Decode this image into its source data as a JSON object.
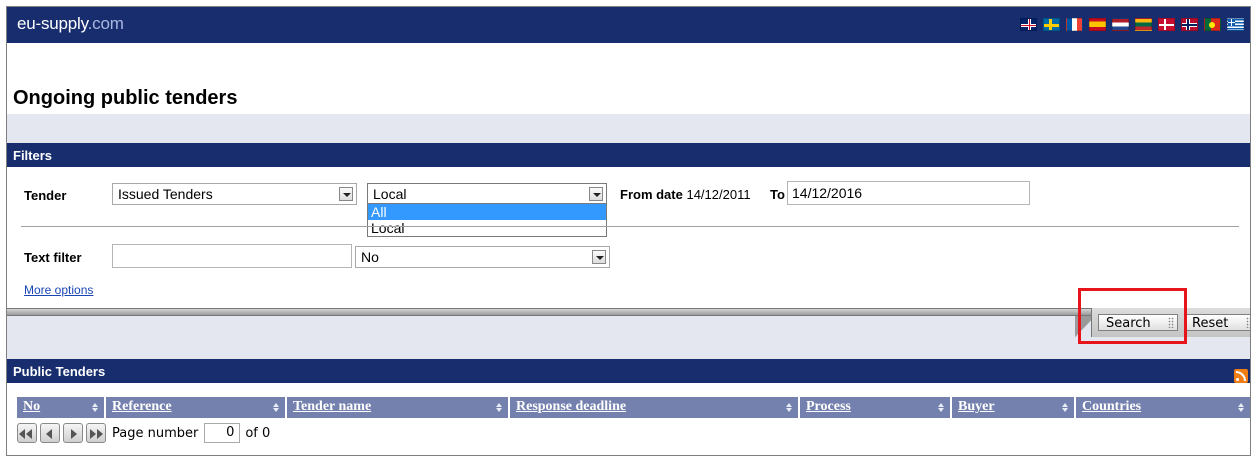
{
  "header": {
    "brand_main": "eu-supply",
    "brand_suffix": ".com",
    "languages": [
      "english-flag",
      "swedish-flag",
      "french-flag",
      "spanish-flag",
      "dutch-flag",
      "lithuanian-flag",
      "danish-flag",
      "norwegian-flag",
      "portuguese-flag",
      "greek-flag"
    ]
  },
  "page_title": "Ongoing public tenders",
  "filters": {
    "header": "Filters",
    "tender_label": "Tender",
    "tender_type_value": "Issued Tenders",
    "scope_value": "Local",
    "scope_options": [
      "All",
      "Local"
    ],
    "scope_highlighted": "All",
    "from_date_label": "From date",
    "from_date_value": "14/12/2011",
    "to_label": "To",
    "to_value": "14/12/2016",
    "text_filter_label": "Text filter",
    "text_filter_value": "",
    "second_select_value": "No",
    "more_options": "More options",
    "search_button": "Search",
    "reset_button": "Reset"
  },
  "results": {
    "header": "Public Tenders",
    "columns": [
      "No",
      "Reference",
      "Tender name",
      "Response deadline",
      "Process",
      "Buyer",
      "Countries"
    ],
    "page_number_label": "Page number",
    "page_number_value": "0",
    "page_total": "of 0"
  },
  "colors": {
    "navy": "#172d6e",
    "table_header": "#7481ae",
    "highlight_box": "#e8141b"
  }
}
